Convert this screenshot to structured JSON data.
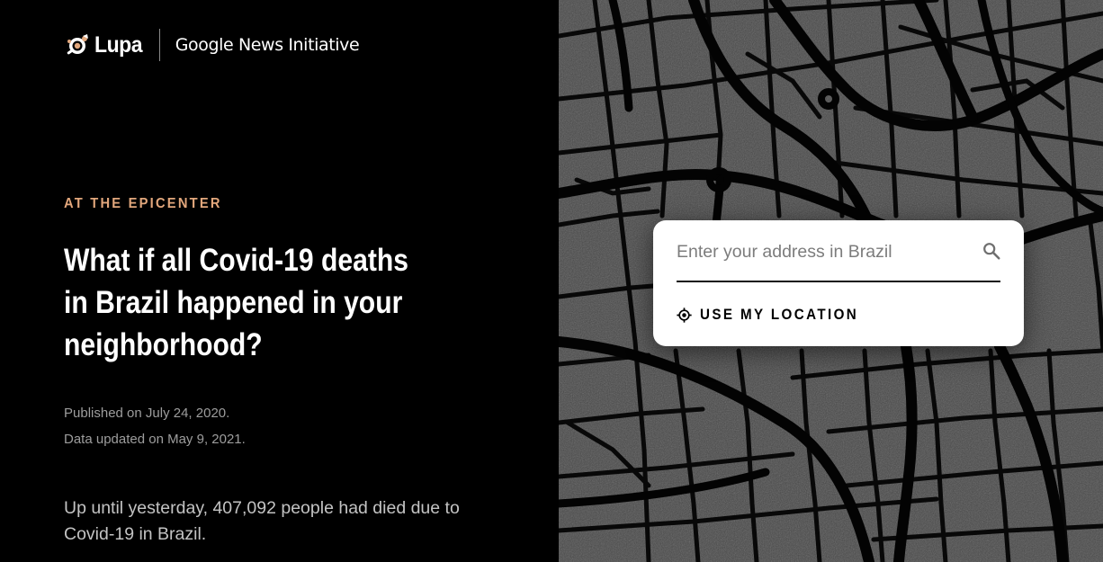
{
  "brand": {
    "lupa_label": "Lupa",
    "partner_label": "Google News Initiative"
  },
  "article": {
    "kicker": "AT THE EPICENTER",
    "headline": "What if all Covid-19 deaths in Brazil happened in your neighborhood?",
    "published": "Published on July 24, 2020.",
    "updated": "Data updated on May 9, 2021.",
    "lead": "Up until yesterday, 407,092 people had died due to Covid-19 in Brazil."
  },
  "search": {
    "placeholder": "Enter your address in Brazil",
    "value": "",
    "location_label": "USE MY LOCATION",
    "search_icon": "search-icon",
    "location_icon": "crosshair-icon"
  },
  "colors": {
    "page_background": "#000000",
    "kicker": "#e2a77c",
    "map_blocks": "#4a4a4a",
    "map_streets": "#050505",
    "card_background": "#ffffff"
  }
}
